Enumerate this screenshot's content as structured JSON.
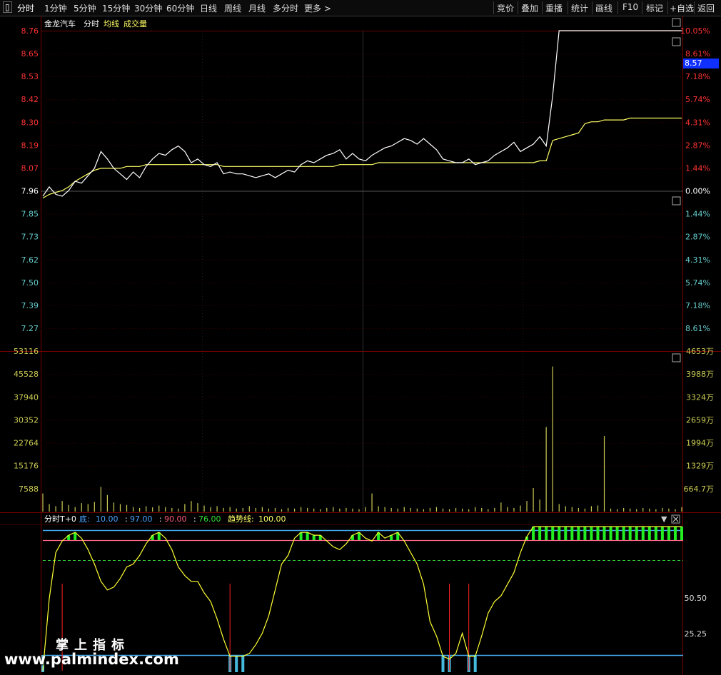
{
  "toolbar": {
    "periods": [
      "分时",
      "1分钟",
      "5分钟",
      "15分钟",
      "30分钟",
      "60分钟",
      "日线",
      "周线",
      "月线",
      "多分时",
      "更多 >"
    ],
    "actions": [
      "竞价",
      "叠加",
      "重播",
      "统计",
      "画线",
      "F10",
      "标记",
      "+自选",
      "返回"
    ]
  },
  "header": {
    "stock_name": "金龙汽车",
    "mode": "分时",
    "avg_line_label": "均线",
    "volume_label": "成交量"
  },
  "price_axis": {
    "left": [
      "8.76",
      "8.65",
      "8.53",
      "8.42",
      "8.30",
      "8.19",
      "8.07",
      "7.96",
      "7.85",
      "7.73",
      "7.62",
      "7.50",
      "7.39",
      "7.27"
    ],
    "right": [
      "10.05%",
      "8.61%",
      "7.18%",
      "5.74%",
      "4.31%",
      "2.87%",
      "1.44%",
      "0.00%",
      "1.44%",
      "2.87%",
      "4.31%",
      "5.74%",
      "7.18%",
      "8.61%"
    ]
  },
  "current_price_badge": "8.57",
  "volume_axis": {
    "left": [
      "53116",
      "45528",
      "37940",
      "30352",
      "22764",
      "15176",
      "7588"
    ],
    "right": [
      "4653万",
      "3988万",
      "3324万",
      "2659万",
      "1994万",
      "1329万",
      "664.7万"
    ]
  },
  "indicator": {
    "name": "分时T+0",
    "params": [
      {
        "label": "底:",
        "value": "10.00",
        "color": "#4aa3ff"
      },
      {
        "label": ":",
        "value": "97.00",
        "color": "#4aa3ff"
      },
      {
        "label": ":",
        "value": "90.00",
        "color": "#ff5a7a"
      },
      {
        "label": ":",
        "value": "76.00",
        "color": "#33dd33"
      },
      {
        "label": "趋势线:",
        "value": "100.00",
        "color": "#ffff66"
      }
    ],
    "axis": [
      "50.50",
      "25.25"
    ]
  },
  "watermark": {
    "cn": "掌上指标",
    "en": "www.palmindex.com"
  },
  "colors": {
    "up": "#ff3333",
    "down": "#66cccc",
    "price_line": "#ffffff",
    "avg_line": "#ffff66",
    "volume": "#cccc55",
    "grid": "#3a0000"
  },
  "chart_data": {
    "type": "line",
    "title": "金龙汽车 分时",
    "prev_close": 7.96,
    "limit_up": 8.76,
    "price_series": [
      7.87,
      7.92,
      7.88,
      7.87,
      7.9,
      7.95,
      7.94,
      7.98,
      8.02,
      8.11,
      8.07,
      8.02,
      7.99,
      7.96,
      8.0,
      7.97,
      8.03,
      8.07,
      8.1,
      8.09,
      8.12,
      8.14,
      8.11,
      8.05,
      8.07,
      8.04,
      8.03,
      8.05,
      7.99,
      8.0,
      7.99,
      7.99,
      7.98,
      7.97,
      7.98,
      7.99,
      7.97,
      7.99,
      8.01,
      8.0,
      8.04,
      8.06,
      8.05,
      8.07,
      8.09,
      8.1,
      8.12,
      8.07,
      8.1,
      8.07,
      8.06,
      8.09,
      8.11,
      8.13,
      8.14,
      8.16,
      8.18,
      8.17,
      8.15,
      8.18,
      8.15,
      8.12,
      8.07,
      8.06,
      8.05,
      8.05,
      8.07,
      8.04,
      8.05,
      8.06,
      8.09,
      8.11,
      8.13,
      8.16,
      8.11,
      8.13,
      8.15,
      8.19,
      8.14,
      8.41,
      8.76,
      8.76,
      8.76,
      8.76,
      8.76,
      8.76,
      8.76,
      8.76,
      8.76,
      8.76,
      8.76,
      8.76,
      8.76,
      8.76,
      8.76,
      8.76,
      8.76,
      8.76,
      8.76,
      8.76
    ],
    "avg_series": [
      7.86,
      7.88,
      7.89,
      7.9,
      7.92,
      7.95,
      7.97,
      7.99,
      8.01,
      8.02,
      8.02,
      8.02,
      8.02,
      8.03,
      8.03,
      8.03,
      8.04,
      8.04,
      8.04,
      8.04,
      8.04,
      8.04,
      8.04,
      8.04,
      8.04,
      8.04,
      8.04,
      8.04,
      8.03,
      8.03,
      8.03,
      8.03,
      8.03,
      8.03,
      8.03,
      8.03,
      8.03,
      8.03,
      8.03,
      8.03,
      8.03,
      8.03,
      8.03,
      8.03,
      8.03,
      8.03,
      8.04,
      8.04,
      8.04,
      8.04,
      8.04,
      8.04,
      8.05,
      8.05,
      8.05,
      8.05,
      8.05,
      8.05,
      8.05,
      8.05,
      8.05,
      8.05,
      8.05,
      8.05,
      8.05,
      8.05,
      8.05,
      8.05,
      8.05,
      8.05,
      8.05,
      8.05,
      8.05,
      8.05,
      8.05,
      8.05,
      8.05,
      8.06,
      8.06,
      8.17,
      8.18,
      8.19,
      8.2,
      8.21,
      8.26,
      8.27,
      8.27,
      8.28,
      8.28,
      8.28,
      8.28,
      8.29,
      8.29,
      8.29,
      8.29,
      8.29,
      8.29,
      8.29,
      8.29,
      8.29
    ],
    "volume_series": [
      6000,
      2500,
      1800,
      3500,
      2200,
      1500,
      2800,
      2500,
      3200,
      8200,
      5500,
      3000,
      2500,
      2200,
      1500,
      1200,
      1800,
      1400,
      2000,
      1500,
      1200,
      1000,
      2500,
      3500,
      2800,
      2000,
      1500,
      1800,
      1200,
      1500,
      1000,
      1200,
      1800,
      1200,
      1500,
      1000,
      1200,
      800,
      1200,
      1000,
      1500,
      1200,
      1000,
      800,
      1200,
      1500,
      1000,
      1200,
      1000,
      800,
      1500,
      6000,
      1800,
      1500,
      1200,
      1000,
      1500,
      1200,
      1000,
      800,
      1200,
      1500,
      1000,
      800,
      1200,
      1000,
      800,
      1500,
      1200,
      800,
      1200,
      3000,
      1500,
      1200,
      2000,
      3500,
      7800,
      4000,
      28000,
      48000,
      2500,
      1800,
      1500,
      1200,
      1000,
      1800,
      2000,
      25000,
      1000,
      800,
      1200,
      1000,
      800,
      1200,
      1000,
      800,
      1200,
      1000,
      800,
      1500
    ],
    "trend_series": [
      0,
      50,
      82,
      90,
      94,
      96,
      92,
      84,
      74,
      62,
      56,
      58,
      64,
      72,
      74,
      80,
      88,
      94,
      96,
      92,
      84,
      72,
      66,
      62,
      62,
      54,
      48,
      36,
      22,
      10,
      10,
      10,
      12,
      18,
      26,
      38,
      56,
      74,
      80,
      92,
      96,
      96,
      94,
      94,
      90,
      86,
      84,
      88,
      94,
      96,
      92,
      90,
      96,
      92,
      94,
      96,
      90,
      82,
      74,
      60,
      34,
      24,
      10,
      8,
      12,
      26,
      10,
      10,
      24,
      40,
      48,
      52,
      60,
      68,
      82,
      93,
      100,
      100,
      100,
      100,
      100,
      100,
      100,
      100,
      100,
      100,
      100,
      100,
      100,
      100,
      100,
      100,
      100,
      100,
      100,
      100,
      100,
      100,
      100,
      100
    ],
    "ylim": [
      7.16,
      8.76
    ],
    "volume_ylim": [
      0,
      53116
    ],
    "trend_ylim": [
      0,
      100
    ],
    "grid": true
  }
}
